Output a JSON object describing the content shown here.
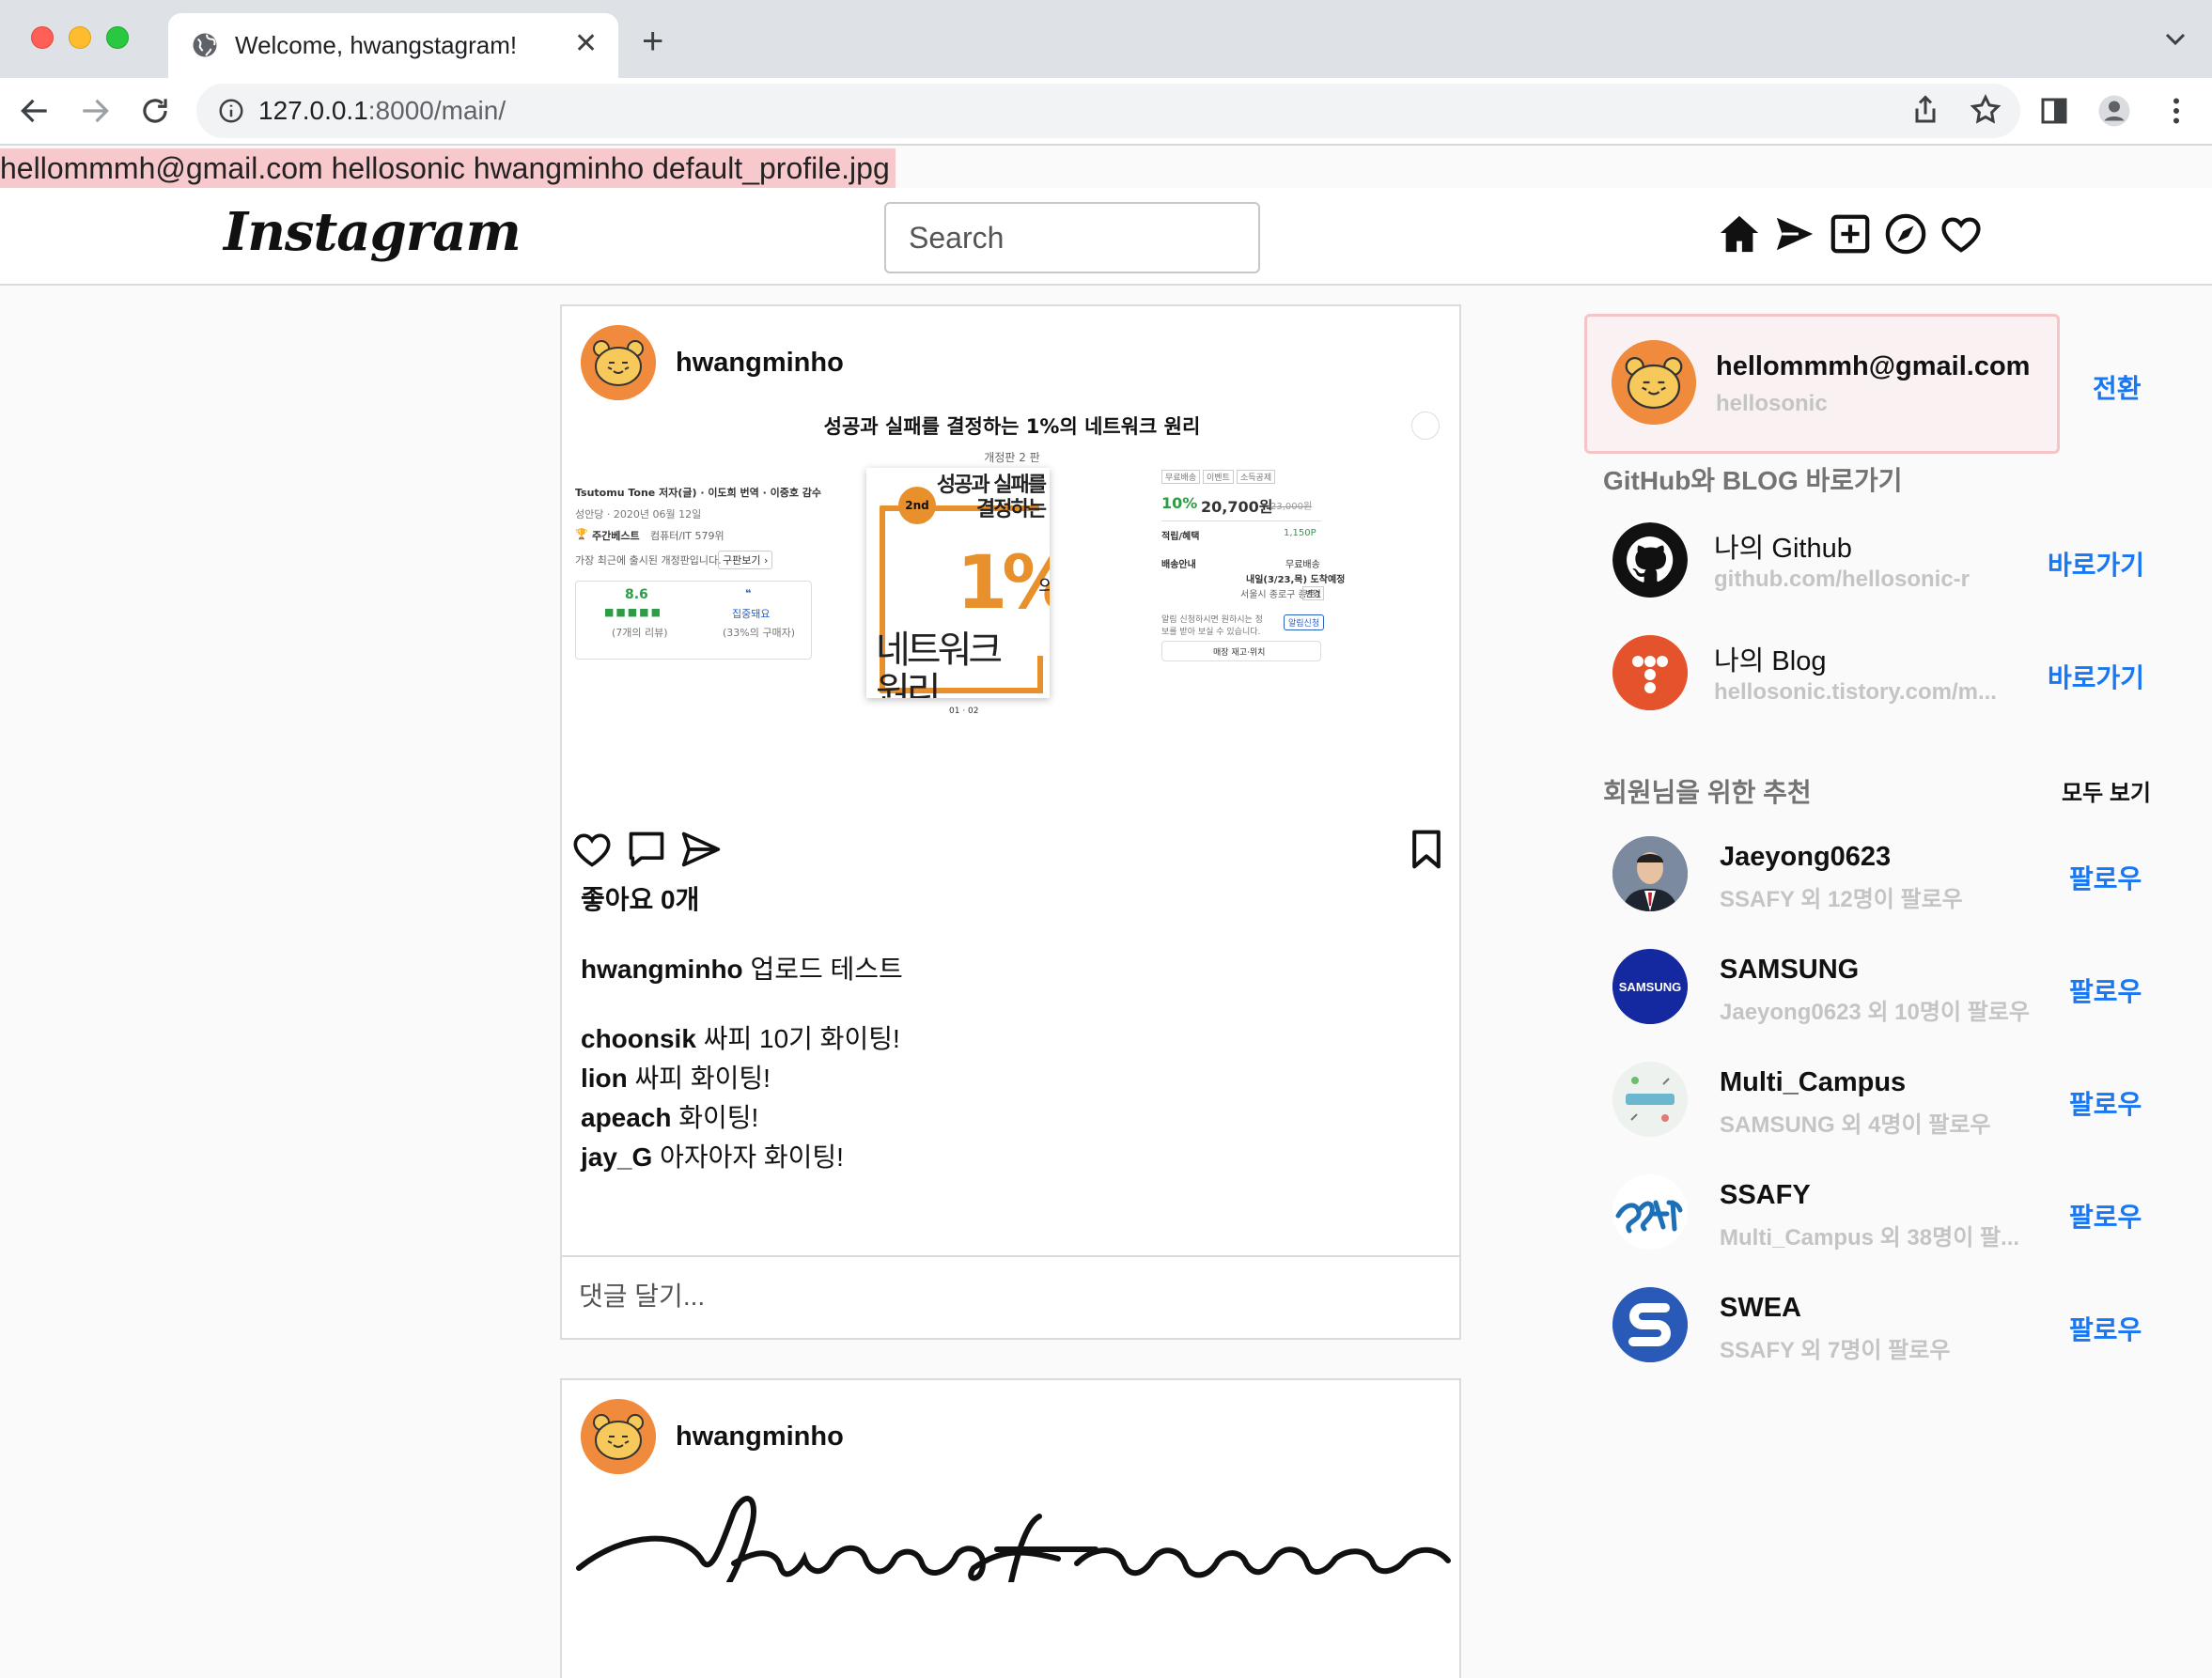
{
  "browser": {
    "tab_title": "Welcome, hwangstagram!",
    "url_host": "127.0.0.1",
    "url_rest": ":8000/main/"
  },
  "debug_text": "hellommmh@gmail.com hellosonic hwangminho default_profile.jpg",
  "header": {
    "logo": "Instagram",
    "search_placeholder": "Search"
  },
  "post1": {
    "username": "hwangminho",
    "book": {
      "title": "성공과 실패를 결정하는 1%의 네트워크 원리",
      "edition": "개정판 2 판",
      "authors": "Tsutomu Tone 저자(글) · 이도희 번역 · 이중호 감수",
      "publisher": "성안당 · 2020년 06월 12일",
      "bestseller": "주간베스트",
      "bestseller_detail": "컴퓨터/IT 579위",
      "note": "가장 최근에 출시된 개정판입니다.",
      "note_btn": "구판보기 ›",
      "rating": "8.6",
      "rating_count": "(7개의 리뷰)",
      "review_tag": "집중돼요",
      "review_pct": "(33%의 구매자)",
      "tags": [
        "무료배송",
        "이벤트",
        "소득공제"
      ],
      "discount": "10%",
      "price": "20,700원",
      "orig_price": "23,000원",
      "points_label": "적립/혜택",
      "points": "1,150P",
      "ship_label": "배송안내",
      "ship_free": "무료배송",
      "ship_date": "내일(3/23,목) 도착예정",
      "ship_place": "서울시 종로구 종로1",
      "ship_change": "변경",
      "alert_text": "알림 신청하시면 원하시는 정보를 받아 보실 수 있습니다.",
      "alert_btn": "알림신청",
      "store_btn": "매장 재고·위치",
      "pager": "01 · 02",
      "cover_title": "성공과 실패를 결정하는",
      "cover_pct": "1%",
      "cover_ui": "의",
      "cover_net": "네트워크 원리",
      "cover_badge": "2nd"
    },
    "likes": "좋아요 0개",
    "caption_user": "hwangminho",
    "caption_text": "업로드 테스트",
    "comments": [
      {
        "user": "choonsik",
        "text": "싸피 10기 화이팅!"
      },
      {
        "user": "lion",
        "text": "싸피 화이팅!"
      },
      {
        "user": "apeach",
        "text": "화이팅!"
      },
      {
        "user": "jay_G",
        "text": "아자아자 화이팅!"
      }
    ],
    "comment_placeholder": "댓글 달기..."
  },
  "post2": {
    "username": "hwangminho"
  },
  "sidebar": {
    "me": {
      "email": "hellommmh@gmail.com",
      "nickname": "hellosonic",
      "switch": "전환"
    },
    "links_heading": "GitHub와 BLOG 바로가기",
    "links": [
      {
        "title": "나의 Github",
        "url": "github.com/hellosonic-r",
        "action": "바로가기"
      },
      {
        "title": "나의 Blog",
        "url": "hellosonic.tistory.com/m...",
        "action": "바로가기"
      }
    ],
    "rec_heading": "회원님을 위한 추천",
    "see_all": "모두 보기",
    "recommendations": [
      {
        "name": "Jaeyong0623",
        "sub": "SSAFY 외 12명이 팔로우",
        "action": "팔로우"
      },
      {
        "name": "SAMSUNG",
        "sub": "Jaeyong0623 외 10명이 팔로우",
        "action": "팔로우"
      },
      {
        "name": "Multi_Campus",
        "sub": "SAMSUNG 외 4명이 팔로우",
        "action": "팔로우"
      },
      {
        "name": "SSAFY",
        "sub": "Multi_Campus 외 38명이 팔...",
        "action": "팔로우"
      },
      {
        "name": "SWEA",
        "sub": "SSAFY 외 7명이 팔로우",
        "action": "팔로우"
      }
    ],
    "samsung_logo": "SAMSUNG"
  },
  "colors": {
    "accent": "#1877f2",
    "highlight": "#f8c9cc",
    "avatar": "#f08a3c",
    "book_orange": "#e8902b"
  }
}
